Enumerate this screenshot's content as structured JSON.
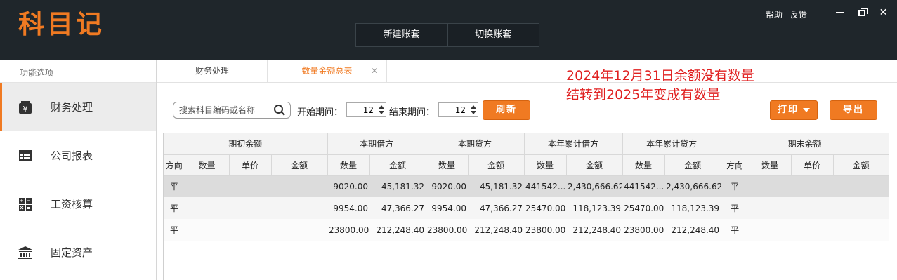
{
  "app": {
    "logo": "科目记",
    "top_actions": [
      "新建账套",
      "切换账套"
    ],
    "help": "帮助",
    "feedback": "反馈"
  },
  "sidebar": {
    "header": "功能选项",
    "items": [
      {
        "label": "财务处理",
        "icon": "yen-box-icon",
        "active": true
      },
      {
        "label": "公司报表",
        "icon": "table-grid-icon",
        "active": false
      },
      {
        "label": "工资核算",
        "icon": "calculator-icon",
        "active": false
      },
      {
        "label": "固定资产",
        "icon": "bank-building-icon",
        "active": false
      }
    ]
  },
  "tabs": [
    {
      "label": "财务处理",
      "active": false
    },
    {
      "label": "数量金额总表",
      "active": true
    }
  ],
  "annotation": {
    "line1": "2024年12月31日余额没有数量",
    "line2": "结转到2025年变成有数量"
  },
  "toolbar": {
    "search_placeholder": "搜索科目编码或名称",
    "start_label": "开始期间：",
    "start_value": "12",
    "end_label": "结束期间：",
    "end_value": "12",
    "refresh": "刷新",
    "print": "打印",
    "export": "导出"
  },
  "colors": {
    "accent": "#f07a22",
    "titlebar": "#1f262b",
    "annotation": "#e02020"
  },
  "table": {
    "groups": [
      "期初余额",
      "本期借方",
      "本期贷方",
      "本年累计借方",
      "本年累计贷方",
      "期末余额"
    ],
    "columns": [
      "方向",
      "数量",
      "单价",
      "金额",
      "数量",
      "金额",
      "数量",
      "金额",
      "数量",
      "金额",
      "数量",
      "金额",
      "方向",
      "数量",
      "单价",
      "金额"
    ],
    "rows": [
      [
        "平",
        "",
        "",
        "",
        "9020.00",
        "45,181.32",
        "9020.00",
        "45,181.32",
        "441542...",
        "2,430,666.62",
        "441542...",
        "2,430,666.62",
        "平",
        "",
        "",
        ""
      ],
      [
        "平",
        "",
        "",
        "",
        "9954.00",
        "47,366.27",
        "9954.00",
        "47,366.27",
        "25470.00",
        "118,123.39",
        "25470.00",
        "118,123.39",
        "平",
        "",
        "",
        ""
      ],
      [
        "平",
        "",
        "",
        "",
        "23800.00",
        "212,248.40",
        "23800.00",
        "212,248.40",
        "23800.00",
        "212,248.40",
        "23800.00",
        "212,248.40",
        "平",
        "",
        "",
        ""
      ]
    ]
  }
}
